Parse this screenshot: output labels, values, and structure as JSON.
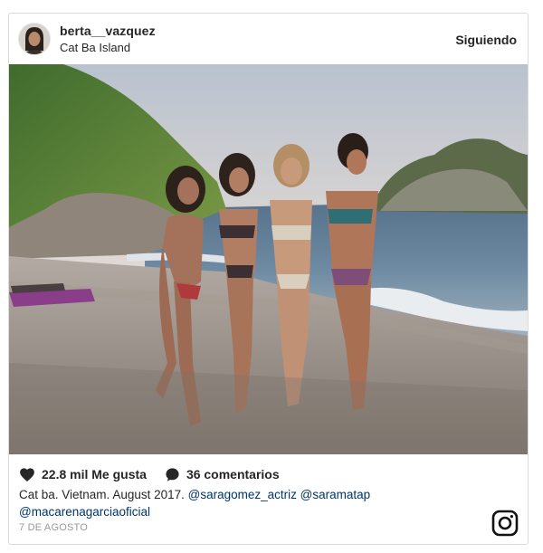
{
  "post": {
    "username": "berta__vazquez",
    "location": "Cat Ba Island",
    "follow_label": "Siguiendo",
    "photo_icon": "beach-group-photo",
    "likes_label": "22.8 mil Me gusta",
    "comments_label": "36 comentarios",
    "caption_text": "Cat ba. Vietnam. August 2017.",
    "mentions": [
      "@saragomez_actriz",
      "@saramatap",
      "@macarenagarciaoficial"
    ],
    "date": "7 DE AGOSTO",
    "icons": [
      "heart-icon",
      "comment-icon",
      "instagram-icon"
    ]
  },
  "colors": {
    "text": "#262626",
    "mention": "#003569",
    "muted": "#999999",
    "border": "#dbdbdb"
  }
}
